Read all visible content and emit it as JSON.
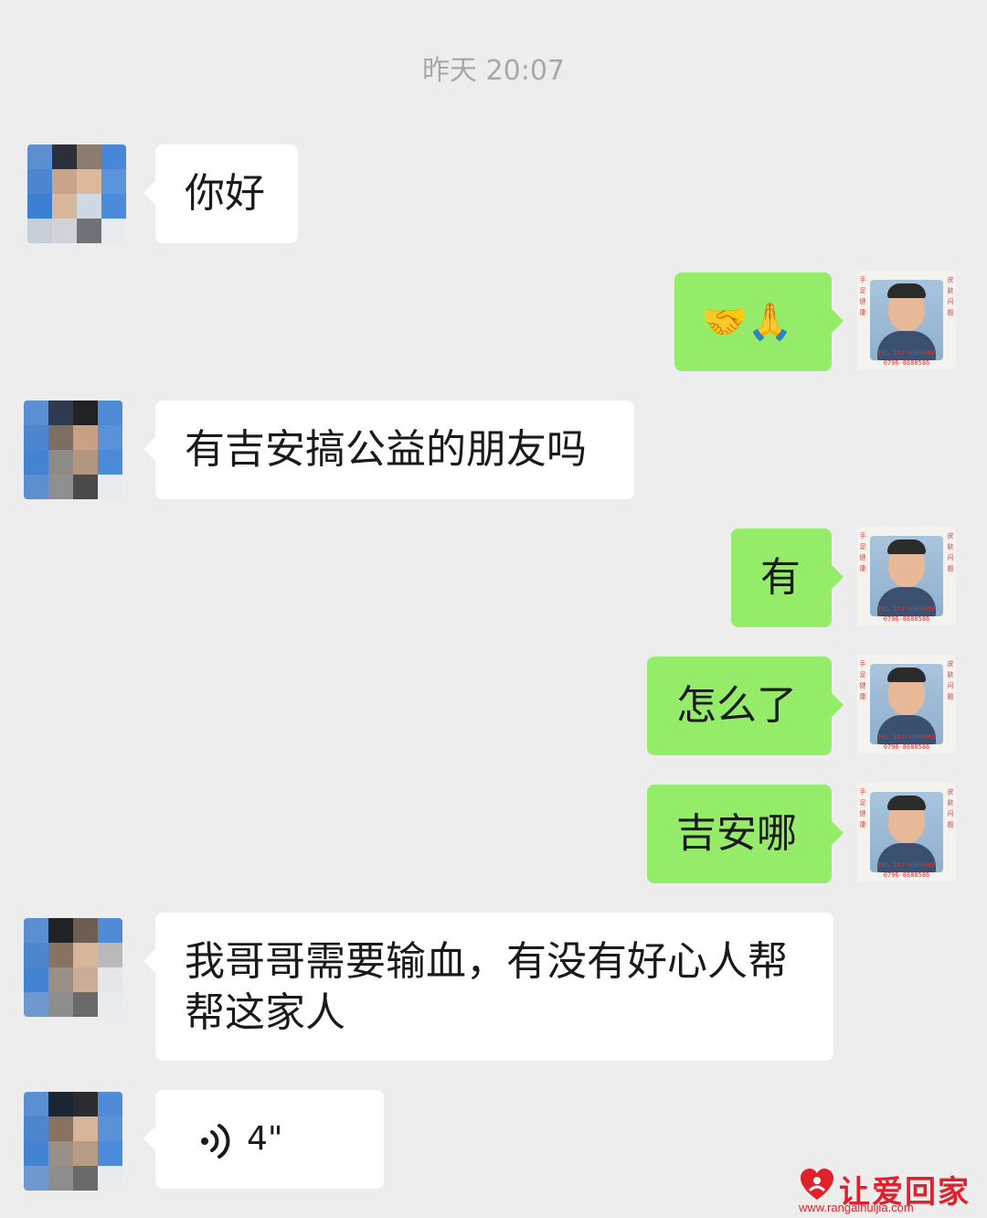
{
  "chat": {
    "timestamp": "昨天 20:07",
    "messages": [
      {
        "side": "in",
        "text": "你好"
      },
      {
        "side": "out",
        "text": "🤝🙏"
      },
      {
        "side": "in",
        "text": "有吉安搞公益的朋友吗"
      },
      {
        "side": "out",
        "text": "有"
      },
      {
        "side": "out",
        "text": "怎么了"
      },
      {
        "side": "out",
        "text": "吉安哪"
      },
      {
        "side": "in",
        "text": "我哥哥需要输血，有没有好心人帮帮这家人"
      },
      {
        "side": "in",
        "type": "voice",
        "duration": "4\""
      }
    ]
  },
  "self_avatar": {
    "side_left": "手足健康",
    "side_right": "皮肤问题",
    "caption_line1": "TEL:18379300086",
    "caption_line2": "0796-8680586"
  },
  "watermark": {
    "text": "让爱回家",
    "url": "www.rangaihuijia.com"
  },
  "colors": {
    "background": "#ededed",
    "incoming_bubble": "#ffffff",
    "outgoing_bubble": "#95ec69",
    "watermark": "#e0202a"
  }
}
